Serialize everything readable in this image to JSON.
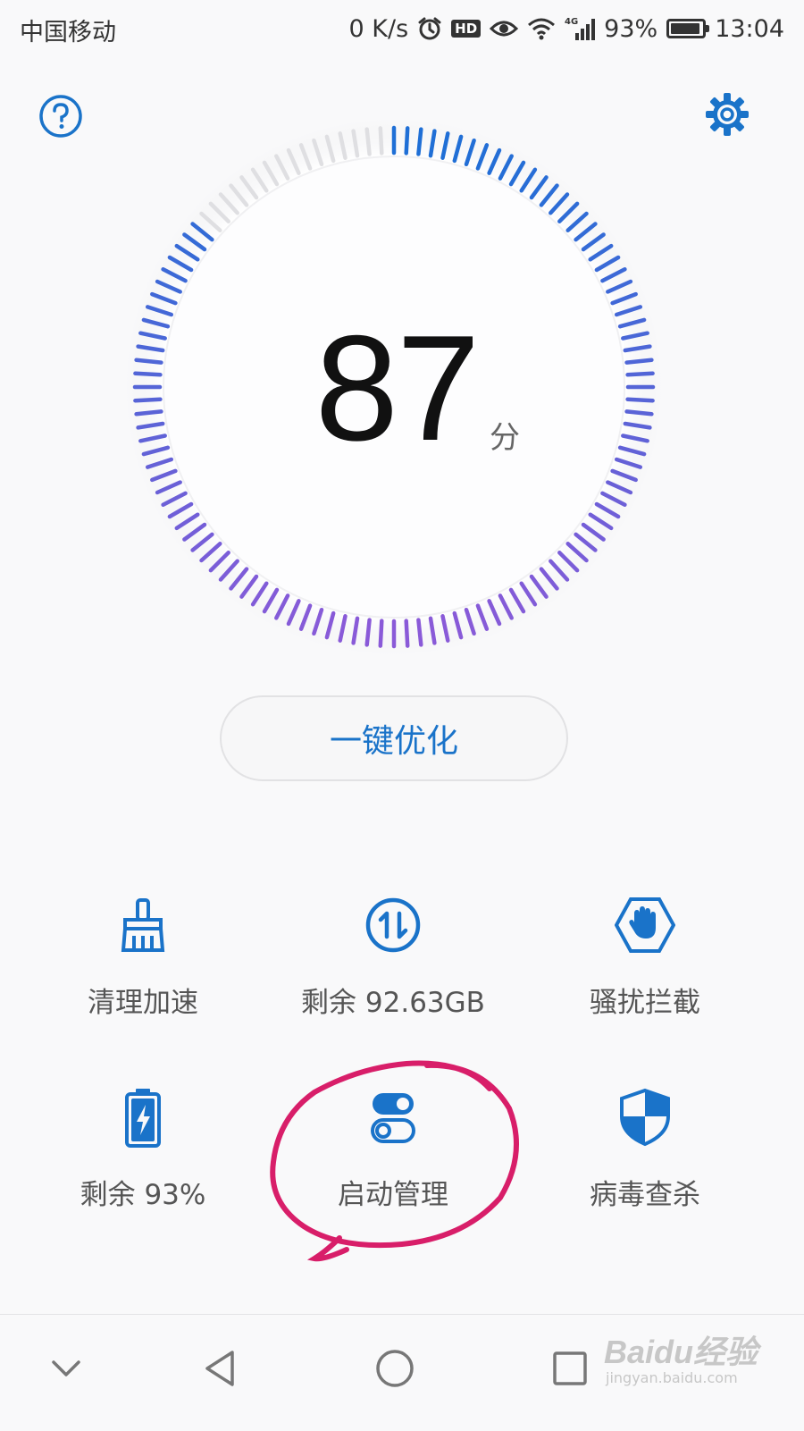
{
  "status_bar": {
    "carrier": "中国移动",
    "net_speed": "0 K/s",
    "hd_badge": "HD",
    "network_type": "4G",
    "battery_percent": "93%",
    "battery_level": 0.93,
    "time": "13:04"
  },
  "header": {
    "help_icon": "question-circle-icon",
    "settings_icon": "gear-icon"
  },
  "gauge": {
    "score": "87",
    "unit": "分",
    "fill_fraction": 0.87,
    "colors": {
      "start": "#1f6fd6",
      "end": "#8a5ad8",
      "empty": "#dfdfe2"
    }
  },
  "optimize_button": {
    "label": "一键优化"
  },
  "tools": [
    {
      "label": "清理加速",
      "icon": "broom-icon"
    },
    {
      "label": "剩余 92.63GB",
      "icon": "storage-arrows-icon"
    },
    {
      "label": "骚扰拦截",
      "icon": "hand-stop-icon"
    },
    {
      "label": "剩余 93%",
      "icon": "battery-charging-icon"
    },
    {
      "label": "启动管理",
      "icon": "toggle-switches-icon"
    },
    {
      "label": "病毒查杀",
      "icon": "shield-icon"
    }
  ],
  "accent_color": "#1a73c9",
  "annotation_color": "#d81e69",
  "nav_bar": {
    "back_icon": "triangle-back-icon",
    "home_icon": "circle-home-icon",
    "recents_icon": "square-recents-icon",
    "collapse_icon": "chevron-down-icon"
  },
  "watermark": {
    "logo": "Baidu经验",
    "url": "jingyan.baidu.com"
  }
}
